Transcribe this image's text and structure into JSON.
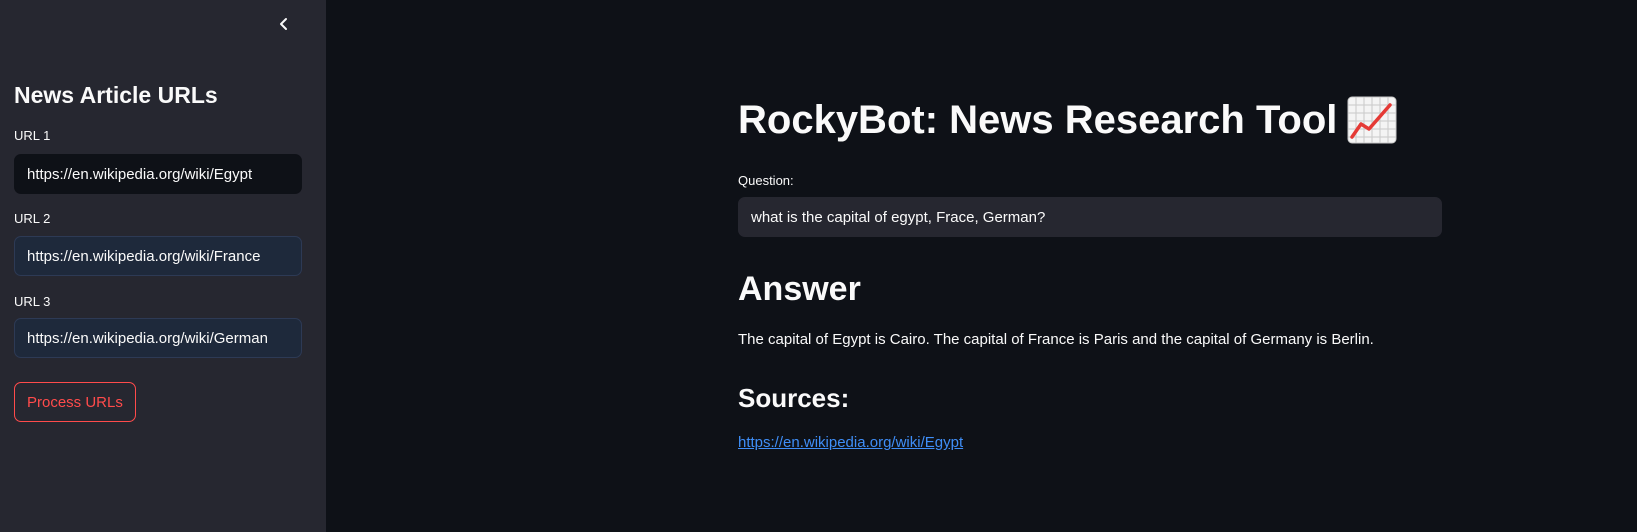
{
  "sidebar": {
    "title": "News Article URLs",
    "collapse_icon": "chevron-left-icon",
    "urls": [
      {
        "label": "URL 1",
        "value": "https://en.wikipedia.org/wiki/Egypt"
      },
      {
        "label": "URL 2",
        "value": "https://en.wikipedia.org/wiki/France"
      },
      {
        "label": "URL 3",
        "value": "https://en.wikipedia.org/wiki/German"
      }
    ],
    "process_button": "Process URLs"
  },
  "main": {
    "title": "RockyBot: News Research Tool",
    "title_icon": "chart-increasing-icon",
    "question_label": "Question:",
    "question_value": "what is the capital of egypt, Frace, German?",
    "answer_heading": "Answer",
    "answer_text": "The capital of Egypt is Cairo. The capital of France is Paris and the capital of Germany is Berlin.",
    "sources_heading": "Sources:",
    "sources": [
      "https://en.wikipedia.org/wiki/Egypt"
    ]
  },
  "colors": {
    "background": "#0e1117",
    "sidebar": "#262730",
    "accent": "#ff4b4b",
    "link": "#3f8ef7"
  }
}
